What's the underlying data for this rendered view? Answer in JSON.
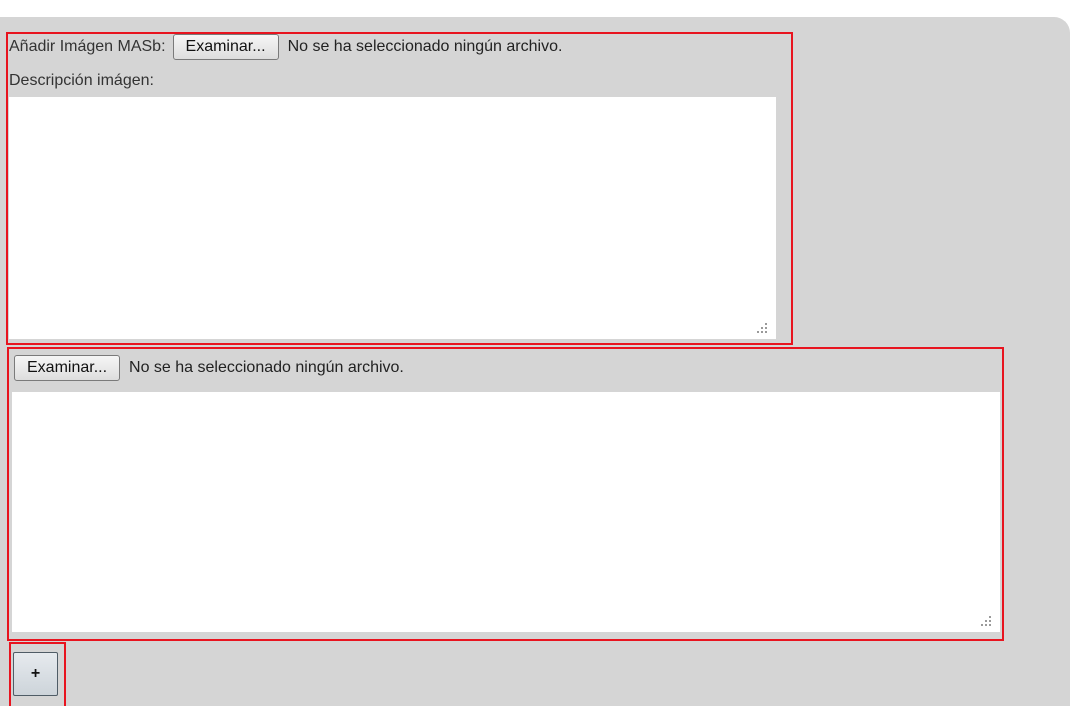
{
  "image_upload": {
    "label": "Añadir Imágen MASb:",
    "browse_button": "Examinar...",
    "file_status": "No se ha seleccionado ningún archivo.",
    "description_label": "Descripción imágen:",
    "description_value": ""
  },
  "second_upload": {
    "browse_button": "Examinar...",
    "file_status": "No se ha seleccionado ningún archivo.",
    "description_value": ""
  },
  "add_button": {
    "label": "+"
  },
  "colors": {
    "panel_background": "#d5d5d5",
    "highlight_border": "#e8141f",
    "textarea_background": "#ffffff"
  }
}
